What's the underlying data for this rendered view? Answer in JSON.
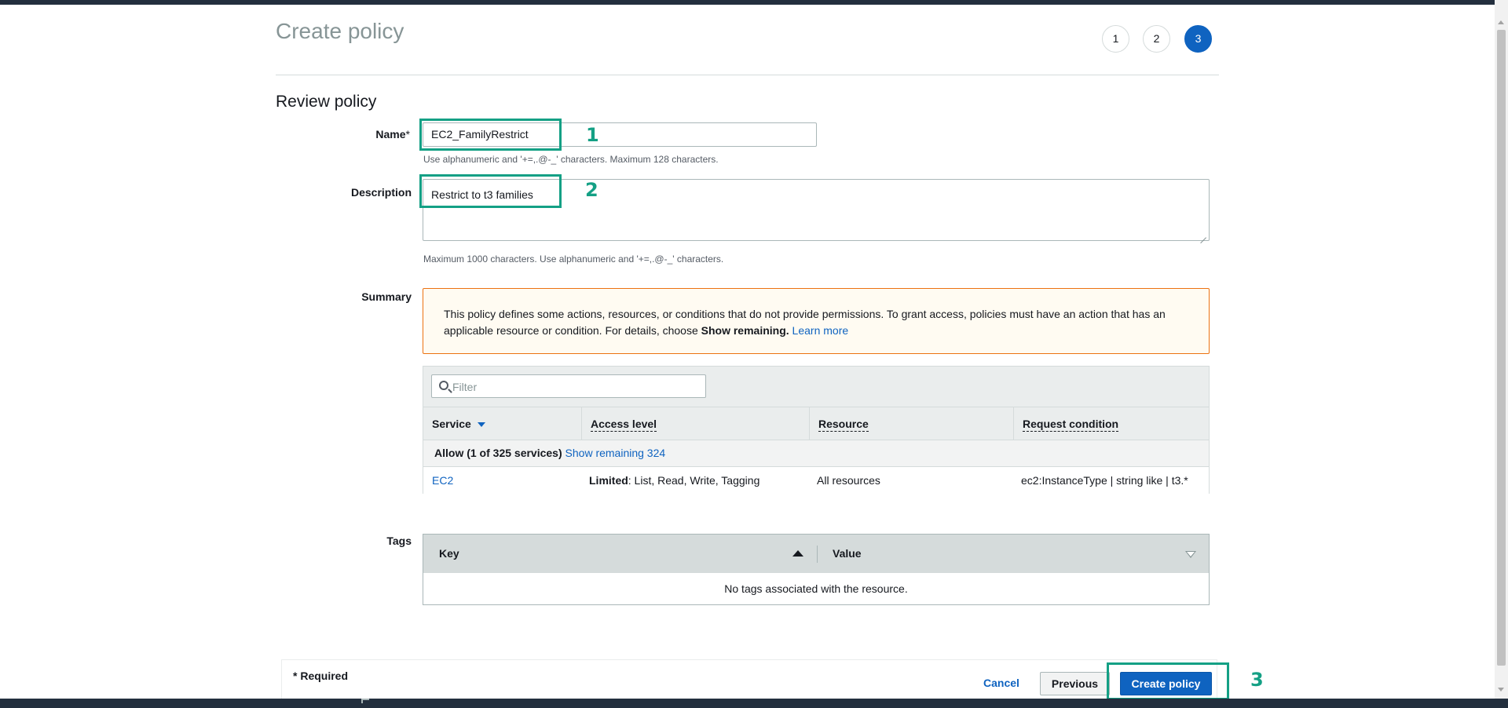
{
  "header": {
    "title": "Create policy",
    "steps": [
      "1",
      "2",
      "3"
    ],
    "section_title": "Review policy"
  },
  "form": {
    "name": {
      "label": "Name",
      "required_mark": "*",
      "value": "EC2_FamilyRestrict",
      "hint": "Use alphanumeric and '+=,.@-_' characters. Maximum 128 characters."
    },
    "description": {
      "label": "Description",
      "value": "Restrict to t3 families",
      "hint": "Maximum 1000 characters. Use alphanumeric and '+=,.@-_' characters."
    }
  },
  "summary": {
    "label": "Summary",
    "warning_text": "This policy defines some actions, resources, or conditions that do not provide permissions. To grant access, policies must have an action that has an applicable resource or condition. For details, choose ",
    "warning_bold": "Show remaining.",
    "warning_link": "Learn more",
    "filter_placeholder": "Filter",
    "columns": [
      "Service",
      "Access level",
      "Resource",
      "Request condition"
    ],
    "group_label": "Allow (1 of 325 services)",
    "group_link": "Show remaining 324",
    "rows": [
      {
        "service": "EC2",
        "access_bold": "Limited",
        "access_rest": ": List, Read, Write, Tagging",
        "resource": "All resources",
        "condition": "ec2:InstanceType | string like | t3.*"
      }
    ]
  },
  "tags": {
    "label": "Tags",
    "columns": [
      "Key",
      "Value"
    ],
    "empty_text": "No tags associated with the resource."
  },
  "footer": {
    "required_note": "* Required",
    "cancel": "Cancel",
    "previous": "Previous",
    "create": "Create policy"
  },
  "annotations": {
    "markers": [
      "1",
      "2",
      "3"
    ],
    "color": "#14a085"
  },
  "colors": {
    "primary": "#0f63c0",
    "warning_border": "#ec7211",
    "warning_bg": "#fffbf2",
    "header_bar": "#232f3e"
  }
}
